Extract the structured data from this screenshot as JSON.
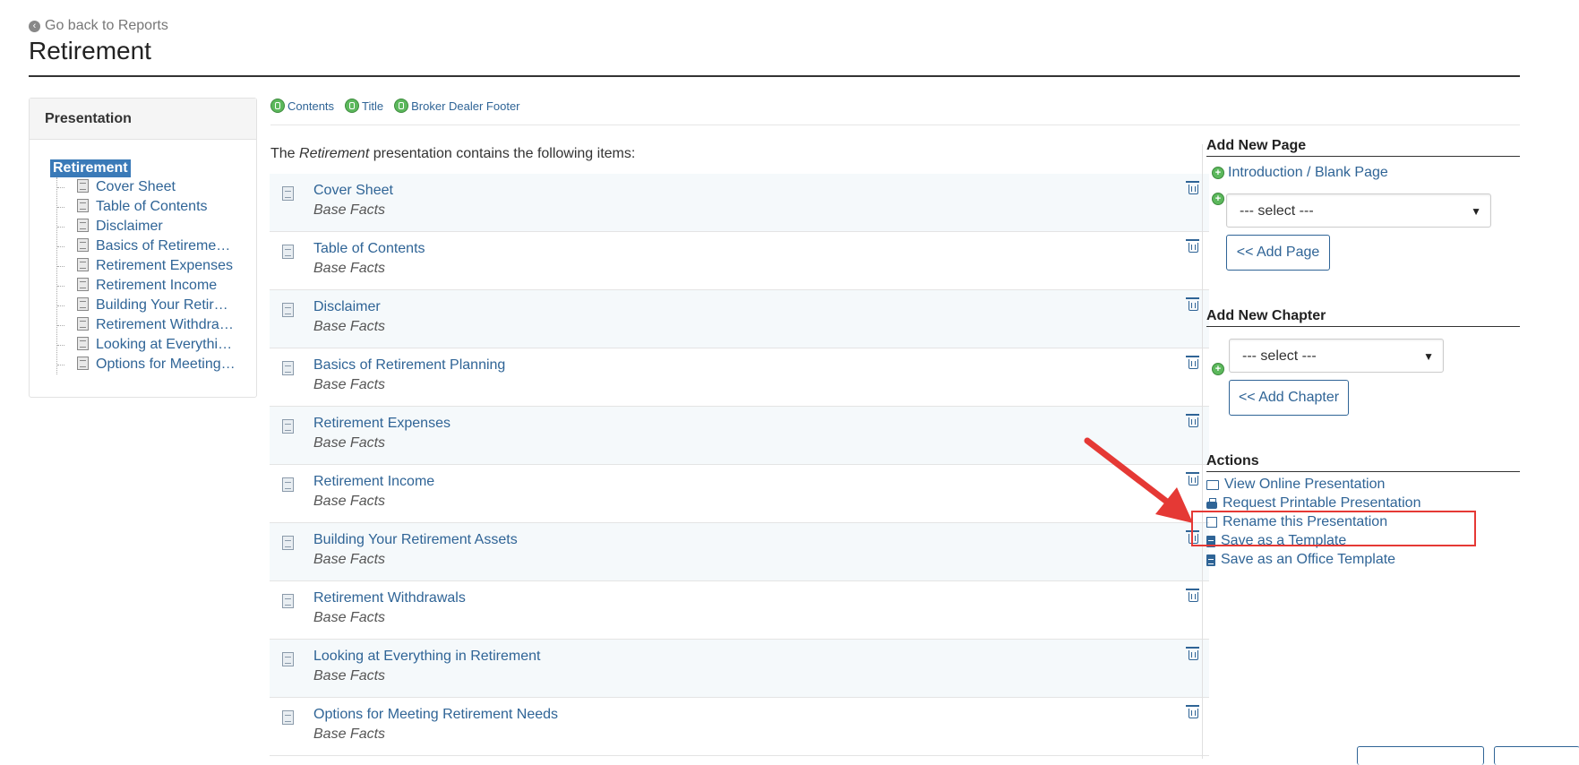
{
  "header": {
    "back_label": "Go back to Reports",
    "title": "Retirement"
  },
  "left_panel": {
    "heading": "Presentation",
    "root": "Retirement",
    "items": [
      "Cover Sheet",
      "Table of Contents",
      "Disclaimer",
      "Basics of Retiremen…",
      "Retirement Expenses",
      "Retirement Income",
      "Building Your Retire…",
      "Retirement Withdra…",
      "Looking at Everythi…",
      "Options for Meeting …"
    ]
  },
  "filters": [
    "Contents",
    "Title",
    "Broker Dealer Footer"
  ],
  "main": {
    "intro_before": "The ",
    "intro_em": "Retirement",
    "intro_after": " presentation contains the following items:",
    "items": [
      {
        "name": "Cover Sheet",
        "sub": "Base Facts"
      },
      {
        "name": "Table of Contents",
        "sub": "Base Facts"
      },
      {
        "name": "Disclaimer",
        "sub": "Base Facts"
      },
      {
        "name": "Basics of Retirement Planning",
        "sub": "Base Facts"
      },
      {
        "name": "Retirement Expenses",
        "sub": "Base Facts"
      },
      {
        "name": "Retirement Income",
        "sub": "Base Facts"
      },
      {
        "name": "Building Your Retirement Assets",
        "sub": "Base Facts"
      },
      {
        "name": "Retirement Withdrawals",
        "sub": "Base Facts"
      },
      {
        "name": "Looking at Everything in Retirement",
        "sub": "Base Facts"
      },
      {
        "name": "Options for Meeting Retirement Needs",
        "sub": "Base Facts"
      }
    ]
  },
  "add_page": {
    "title": "Add New Page",
    "blank_link": "Introduction / Blank Page",
    "select_value": "--- select ---",
    "button": "<< Add Page"
  },
  "add_chapter": {
    "title": "Add New Chapter",
    "select_value": "--- select ---",
    "button": "<< Add Chapter"
  },
  "actions": {
    "title": "Actions",
    "view_online": "View Online Presentation",
    "request_printable": "Request Printable Presentation",
    "rename": "Rename this Presentation",
    "save_template": "Save as a Template",
    "save_office_template": "Save as an Office Template"
  },
  "colors": {
    "link": "#2f6496",
    "highlight": "#e53935",
    "toggle_on": "#5cb85c"
  }
}
